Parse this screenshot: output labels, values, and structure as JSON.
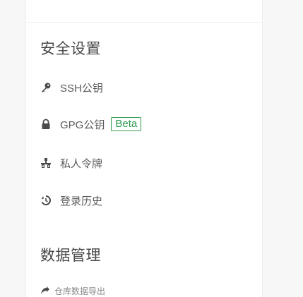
{
  "security_section": {
    "title": "安全设置",
    "items": [
      {
        "label": "SSH公钥",
        "icon": "key-icon"
      },
      {
        "label": "GPG公钥",
        "icon": "lock-icon",
        "badge": "Beta"
      },
      {
        "label": "私人令牌",
        "icon": "token-icon"
      },
      {
        "label": "登录历史",
        "icon": "history-icon"
      }
    ]
  },
  "data_section": {
    "title": "数据管理",
    "items": [
      {
        "label": "仓库数据导出",
        "icon": "export-icon"
      }
    ]
  },
  "colors": {
    "accent_green": "#2e9b4f",
    "icon_dark": "#4a4a4a"
  }
}
